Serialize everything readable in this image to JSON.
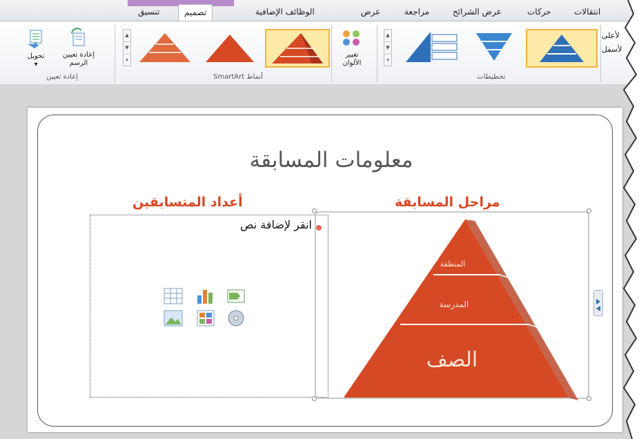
{
  "tabs": {
    "transitions": "انتقالات",
    "animations": "حركات",
    "slideshow": "عرض الشرائح",
    "review": "مراجعة",
    "view": "عرض",
    "addins": "الوظائف الإضافية",
    "design": "تصميم",
    "format": "تنسيق"
  },
  "ribbon": {
    "promote_cut": "لأعلى",
    "demote_cut": "لأسفل",
    "layouts_group": "تخطيطات",
    "change_colors": "تغيير",
    "change_colors_2": "الألوان",
    "smartart_styles_group": "أنماط SmartArt",
    "reset_graphic": "إعادة تعيين",
    "reset_graphic_2": "الرسم",
    "convert": "تحويل",
    "reset_group": "إعادة تعيين"
  },
  "slide": {
    "title": "معلومات المسابقة",
    "left_heading": "أعداد المتسابقين",
    "right_heading": "مراحل المسابقة",
    "placeholder_text": "انقر لإضافة نص",
    "pyramid": [
      "المنطقة",
      "المدرسة",
      "الصف"
    ]
  },
  "colors": {
    "accent": "#d64925",
    "selected_gallery": "#f2b43b",
    "layout_blue": "#2f6fb8"
  }
}
